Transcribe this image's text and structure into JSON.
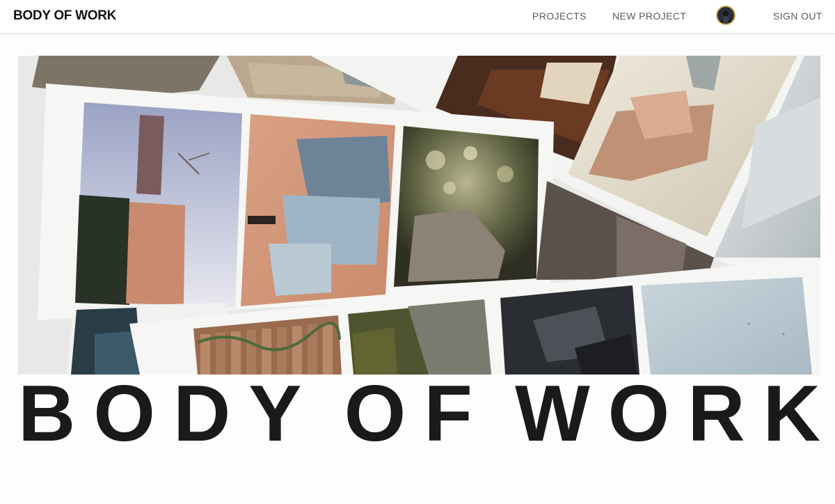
{
  "header": {
    "brand": "BODY OF WORK",
    "nav": {
      "projects": "PROJECTS",
      "new_project": "NEW PROJECT",
      "sign_out": "SIGN OUT"
    },
    "avatar_icon": "user-avatar-icon"
  },
  "hero": {
    "image_description_icon": "photo-collage-image"
  },
  "title": {
    "word1": "BODY",
    "word2": "OF",
    "word3": "WORK"
  },
  "colors": {
    "text": "#1a1a1a",
    "nav_text": "#5a5a5a",
    "background": "#fdfdfd"
  }
}
